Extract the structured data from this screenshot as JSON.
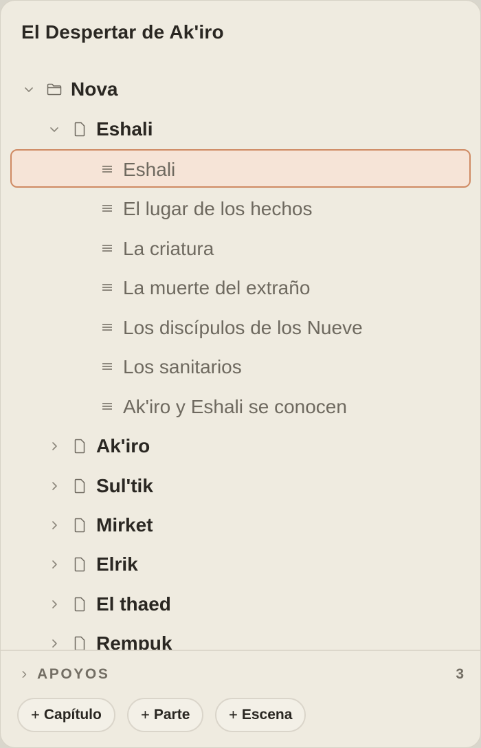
{
  "panel": {
    "title": "El Despertar de Ak'iro"
  },
  "tree": {
    "root": {
      "label": "Nova",
      "icon": "folder-icon",
      "expanded": true
    },
    "chapters": [
      {
        "label": "Eshali",
        "icon": "document-icon",
        "expanded": true,
        "scenes": [
          {
            "label": "Eshali",
            "selected": true
          },
          {
            "label": "El lugar de los hechos"
          },
          {
            "label": "La criatura"
          },
          {
            "label": "La muerte del extraño"
          },
          {
            "label": "Los discípulos de los Nueve"
          },
          {
            "label": "Los sanitarios"
          },
          {
            "label": "Ak'iro y Eshali se conocen"
          }
        ]
      },
      {
        "label": "Ak'iro",
        "icon": "document-icon",
        "expanded": false
      },
      {
        "label": "Sul'tik",
        "icon": "document-icon",
        "expanded": false
      },
      {
        "label": "Mirket",
        "icon": "document-icon",
        "expanded": false
      },
      {
        "label": "Elrik",
        "icon": "document-icon",
        "expanded": false
      },
      {
        "label": "El thaed",
        "icon": "document-icon",
        "expanded": false
      },
      {
        "label": "Rempuk",
        "icon": "document-icon",
        "expanded": false
      }
    ]
  },
  "apoyos": {
    "label": "APOYOS",
    "count": "3"
  },
  "actions": {
    "plus_symbol": "+",
    "chapter_label": "Capítulo",
    "part_label": "Parte",
    "scene_label": "Escena"
  },
  "colors": {
    "panel_bg": "#efebe0",
    "selected_bg": "#f6e4d7",
    "selected_border": "#cf8a63",
    "text_primary": "#2a2722",
    "text_secondary": "#6e695f"
  }
}
